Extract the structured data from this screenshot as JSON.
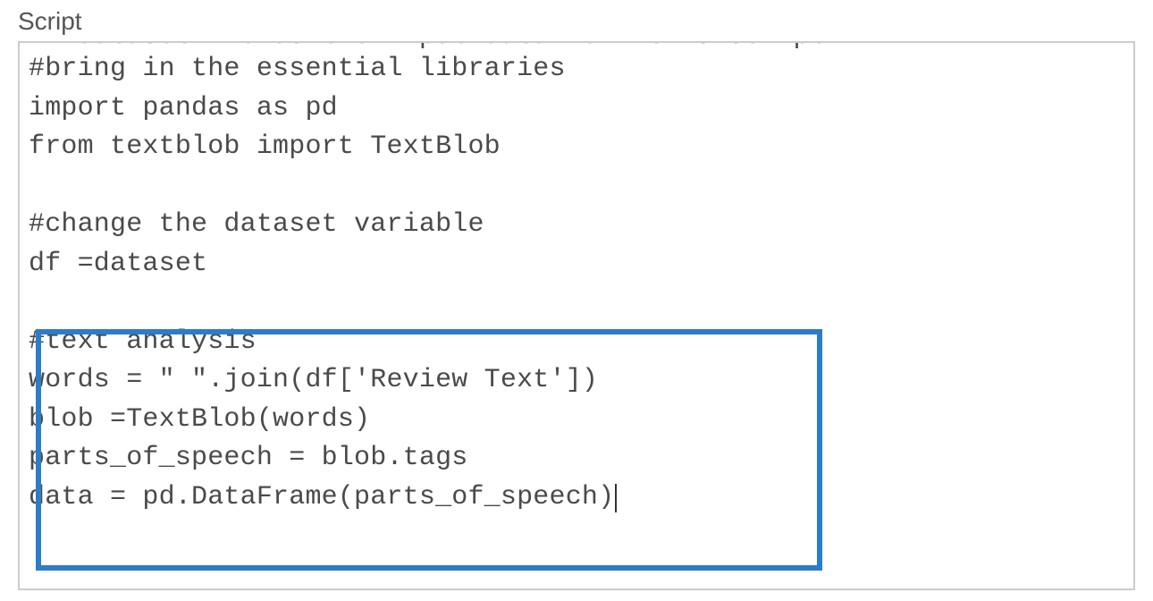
{
  "section": {
    "label": "Script"
  },
  "code": {
    "truncated_line": "#  dataset  holds the input data for  this script",
    "line1": "#bring in the essential libraries",
    "line2": "import pandas as pd",
    "line3": "from textblob import TextBlob",
    "line4": "",
    "line5": "#change the dataset variable",
    "line6": "df =dataset",
    "line7": "",
    "line8": "#text analysis",
    "line9": "words = \" \".join(df['Review Text'])",
    "line10": "blob =TextBlob(words)",
    "line11": "parts_of_speech = blob.tags",
    "line12": "data = pd.DataFrame(parts_of_speech)"
  },
  "highlight": {
    "color": "#2d7cc9"
  }
}
